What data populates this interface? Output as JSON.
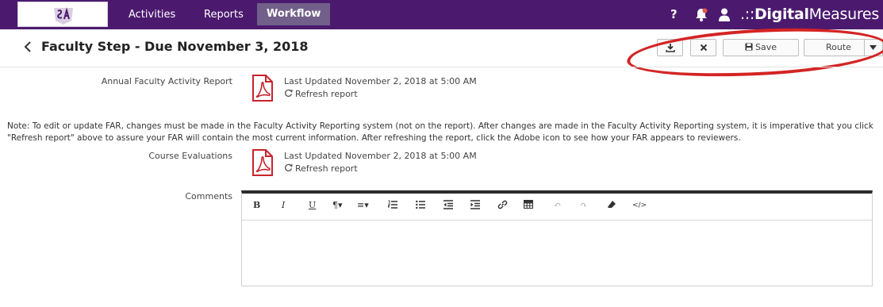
{
  "nav": {
    "items": [
      "Activities",
      "Reports",
      "Workflow"
    ],
    "active": "Workflow",
    "help_label": "?",
    "brand_prefix": ".::",
    "brand_bold": "Digital",
    "brand_rest": "Measures"
  },
  "header": {
    "title": "Faculty Step - Due November 3, 2018",
    "save_label": "Save",
    "route_label": "Route"
  },
  "reports": [
    {
      "label": "Annual Faculty Activity Report",
      "last_updated": "Last Updated November 2, 2018 at 5:00 AM",
      "refresh_label": "Refresh report"
    },
    {
      "label": "Course Evaluations",
      "last_updated": "Last Updated November 2, 2018 at 5:00 AM",
      "refresh_label": "Refresh report"
    }
  ],
  "note": "Note: To edit or update FAR, changes must be made in the Faculty Activity Reporting system (not on the report). After changes are made in the Faculty Activity Reporting system, it is imperative that you click \"Refresh report\" above to assure your FAR will contain the most current information. After refreshing the report, click the Adobe icon to see how your FAR appears to reviewers.",
  "comments": {
    "label": "Comments",
    "toolbar": {
      "bold": "B",
      "italic": "I",
      "underline": "U",
      "paragraph": "¶▾",
      "align": "≡▾",
      "undo": "↶",
      "redo": "↷",
      "code": "</>"
    }
  },
  "colors": {
    "nav_bg": "#4b1a6e",
    "nav_active_bg": "#72608a",
    "annotation": "#d42424",
    "pdf_red": "#c8232c",
    "editor_border_top": "#2b2b2b"
  }
}
